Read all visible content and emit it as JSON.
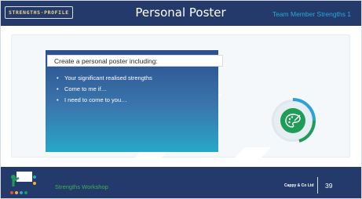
{
  "header": {
    "logo_text": "STRENGTHS·PROFILE",
    "title": "Personal Poster",
    "subtitle": "Team Member Strengths 1"
  },
  "card": {
    "headline": "Create a personal poster including:",
    "bullets": [
      "Your significant realised strengths",
      "Come to me if…",
      "I need to come to you…"
    ]
  },
  "footer": {
    "workshop_label": "Strengths Workshop",
    "copyright": "Cappy & Co Ltd",
    "page_number": "39"
  },
  "icons": {
    "palette": "palette-icon",
    "footer_logo": "easel-logo-icon"
  },
  "colors": {
    "header_bg": "#243a6b",
    "accent_blue": "#29a8d8",
    "accent_green": "#3cb44b",
    "icon_green": "#1f9c57",
    "card_gradient_top": "#2d4f8c",
    "card_gradient_bottom": "#28a7c8"
  }
}
